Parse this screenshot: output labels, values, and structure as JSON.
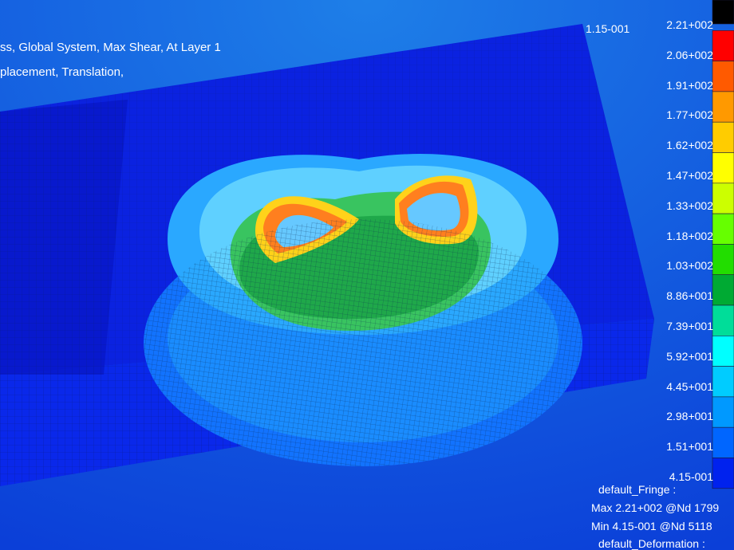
{
  "header": {
    "line1": "ss, Global System, Max Shear, At Layer 1",
    "line2": "placement, Translation,",
    "top_value": "1.15-001"
  },
  "legend": {
    "ticks": [
      "2.21+002",
      "2.06+002",
      "1.91+002",
      "1.77+002",
      "1.62+002",
      "1.47+002",
      "1.33+002",
      "1.18+002",
      "1.03+002",
      "8.86+001",
      "7.39+001",
      "5.92+001",
      "4.45+001",
      "2.98+001",
      "1.51+001",
      "4.15-001"
    ],
    "colors": [
      "#000000",
      "#ff0000",
      "#ff5a00",
      "#ff9900",
      "#ffcc00",
      "#ffff00",
      "#ccff00",
      "#66ff00",
      "#22dd00",
      "#00aa33",
      "#00dd99",
      "#00ffff",
      "#00ccff",
      "#0099ff",
      "#0066ff",
      "#0022ee"
    ]
  },
  "info": {
    "fringe_title": "default_Fringe :",
    "max_line": "Max 2.21+002 @Nd 1799",
    "min_line": "Min 4.15-001 @Nd 5118",
    "deformation_title": "default_Deformation :"
  }
}
